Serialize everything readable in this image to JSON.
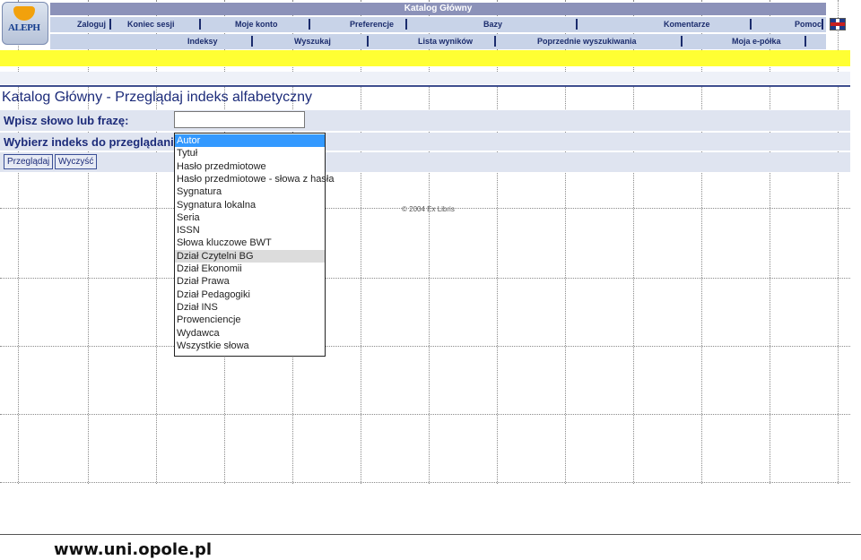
{
  "header": {
    "title": "Katalog Główny",
    "logo_text": "ALEPH",
    "nav_top": [
      "Zaloguj",
      "Koniec sesji",
      "Moje konto",
      "Preferencje",
      "Bazy",
      "Komentarze",
      "Pomoc"
    ],
    "nav_bottom": [
      "Indeksy",
      "Wyszukaj",
      "Lista wyników",
      "Poprzednie wyszukiwania",
      "Moja e-półka"
    ]
  },
  "main": {
    "page_title": "Katalog Główny - Przeglądaj indeks alfabetyczny",
    "word_label": "Wpisz słowo lub frazę:",
    "word_value": "",
    "index_label": "Wybierz indeks do przeglądania:",
    "browse_button": "Przeglądaj",
    "clear_button": "Wyczyść",
    "index_options": [
      "Autor",
      "Tytuł",
      "Hasło przedmiotowe",
      "Hasło przedmiotowe - słowa z hasła",
      "Sygnatura",
      "Sygnatura lokalna",
      "Seria",
      "ISSN",
      "Słowa kluczowe BWT",
      "Dział Czytelni BG",
      "Dział Ekonomii",
      "Dział Prawa",
      "Dział Pedagogiki",
      "Dział INS",
      "Prowenciencje",
      "Wydawca",
      "Wszystkie słowa"
    ],
    "selected_option": "Autor",
    "hovered_option": "Dział Czytelni BG",
    "copyright": "© 2004 Ex Libris"
  },
  "footer": {
    "url": "www.uni.opole.pl"
  },
  "colors": {
    "nav_bg": "#c8d3e8",
    "title_bg": "#8c92b9",
    "highlight_bar": "#ffff33",
    "selection": "#3399ff"
  }
}
